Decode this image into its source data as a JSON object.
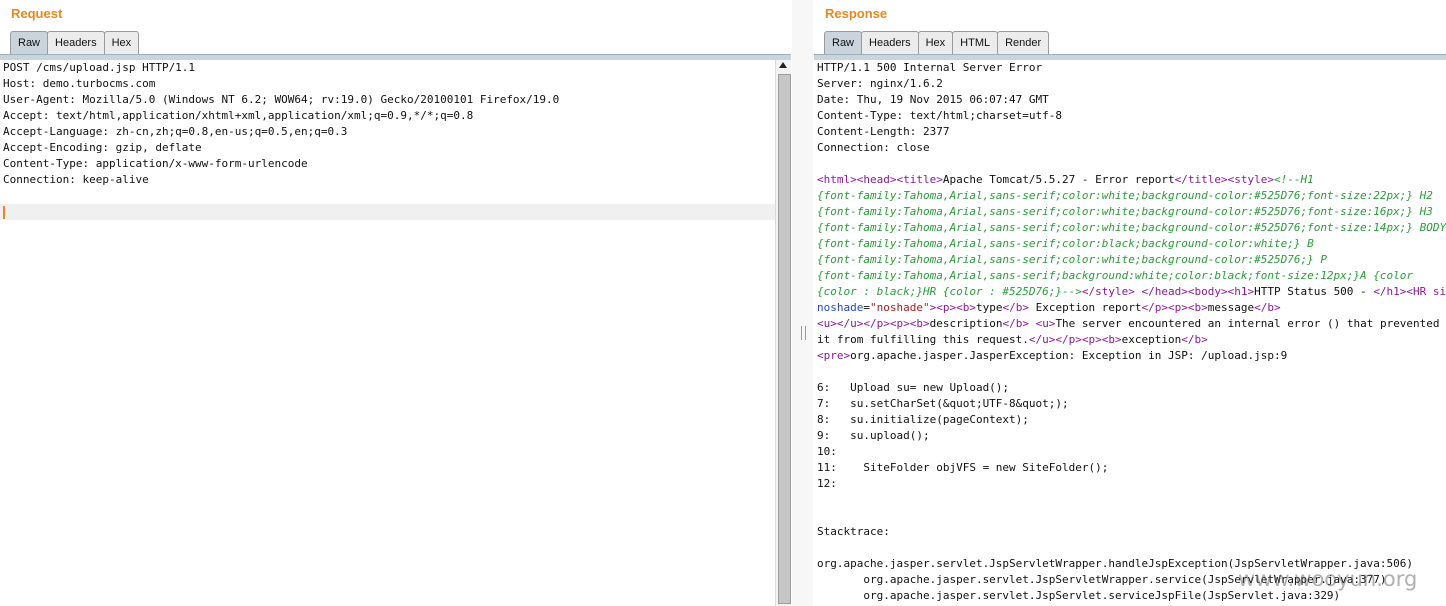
{
  "request": {
    "title": "Request",
    "tabs": [
      "Raw",
      "Headers",
      "Hex"
    ],
    "lines": [
      "POST /cms/upload.jsp HTTP/1.1",
      "Host: demo.turbocms.com",
      "User-Agent: Mozilla/5.0 (Windows NT 6.2; WOW64; rv:19.0) Gecko/20100101 Firefox/19.0",
      "Accept: text/html,application/xhtml+xml,application/xml;q=0.9,*/*;q=0.8",
      "Accept-Language: zh-cn,zh;q=0.8,en-us;q=0.5,en;q=0.3",
      "Accept-Encoding: gzip, deflate",
      "Content-Type: application/x-www-form-urlencode",
      "Connection: keep-alive"
    ]
  },
  "response": {
    "title": "Response",
    "tabs": [
      "Raw",
      "Headers",
      "Hex",
      "HTML",
      "Render"
    ],
    "headers": [
      "HTTP/1.1 500 Internal Server Error",
      "Server: nginx/1.6.2",
      "Date: Thu, 19 Nov 2015 06:07:47 GMT",
      "Content-Type: text/html;charset=utf-8",
      "Content-Length: 2377",
      "Connection: close"
    ],
    "body": {
      "l1_title": "Apache Tomcat/5.5.27 - Error report",
      "l1_css": "<!--H1",
      "css_lines": [
        "{font-family:Tahoma,Arial,sans-serif;color:white;background-color:#525D76;font-size:22px;} H2",
        "{font-family:Tahoma,Arial,sans-serif;color:white;background-color:#525D76;font-size:16px;} H3",
        "{font-family:Tahoma,Arial,sans-serif;color:white;background-color:#525D76;font-size:14px;} BODY",
        "{font-family:Tahoma,Arial,sans-serif;color:black;background-color:white;} B",
        "{font-family:Tahoma,Arial,sans-serif;color:white;background-color:#525D76;} P",
        "{font-family:Tahoma,Arial,sans-serif;background:white;color:black;font-size:12px;}A {color"
      ],
      "css_end": "{color : black;}HR {color : #525D76;}-->",
      "h1_text": "HTTP Status 500 - ",
      "noshade_attr": "noshade",
      "noshade_val": "\"noshade\"",
      "type_label": "type",
      "type_value": " Exception report",
      "message_label": "message",
      "description_label": "description",
      "description_text": "The server encountered an internal error () that prevented",
      "description_cont": "it from fulfilling this request.",
      "exception_label": "exception",
      "pre_text": "org.apache.jasper.JasperException: Exception in JSP: /upload.jsp:9",
      "code_lines": [
        "6:   Upload su= new Upload();",
        "7:   su.setCharSet(&quot;UTF-8&quot;);",
        "8:   su.initialize(pageContext);",
        "9:   su.upload();",
        "10:",
        "11:    SiteFolder objVFS = new SiteFolder();",
        "12:"
      ],
      "stacktrace_label": "Stacktrace:",
      "stack_lines": [
        "org.apache.jasper.servlet.JspServletWrapper.handleJspException(JspServletWrapper.java:506)",
        "       org.apache.jasper.servlet.JspServletWrapper.service(JspServletWrapper.java:377)",
        "       org.apache.jasper.servlet.JspServlet.serviceJspFile(JspServlet.java:329)"
      ]
    }
  },
  "watermark": "www.wooyun.org"
}
